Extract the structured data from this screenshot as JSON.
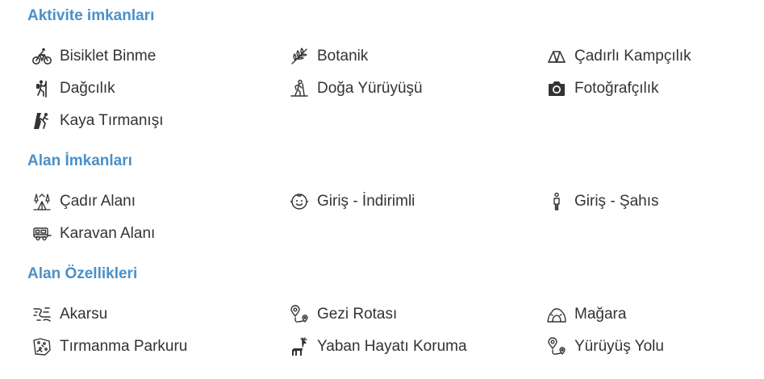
{
  "sections": {
    "activity": {
      "title": "Aktivite imkanları",
      "items": [
        {
          "label": "Bisiklet Binme",
          "icon": "bicycle-icon"
        },
        {
          "label": "Botanik",
          "icon": "leaf-icon"
        },
        {
          "label": "Çadırlı Kampçılık",
          "icon": "tent-icon"
        },
        {
          "label": "Dağcılık",
          "icon": "climber-icon"
        },
        {
          "label": "Doğa Yürüyüşü",
          "icon": "hiker-icon"
        },
        {
          "label": "Fotoğrafçılık",
          "icon": "camera-icon"
        },
        {
          "label": "Kaya Tırmanışı",
          "icon": "rock-climbing-icon"
        }
      ]
    },
    "facilities": {
      "title": "Alan İmkanları",
      "items": [
        {
          "label": "Çadır Alanı",
          "icon": "camp-area-icon"
        },
        {
          "label": "Giriş - İndirimli",
          "icon": "child-face-icon"
        },
        {
          "label": "Giriş - Şahıs",
          "icon": "person-icon"
        },
        {
          "label": "Karavan Alanı",
          "icon": "caravan-icon"
        }
      ]
    },
    "features": {
      "title": "Alan Özellikleri",
      "items": [
        {
          "label": "Akarsu",
          "icon": "river-icon"
        },
        {
          "label": "Gezi Rotası",
          "icon": "route-icon"
        },
        {
          "label": "Mağara",
          "icon": "cave-icon"
        },
        {
          "label": "Tırmanma Parkuru",
          "icon": "climbing-wall-icon"
        },
        {
          "label": "Yaban Hayatı Koruma",
          "icon": "deer-icon"
        },
        {
          "label": "Yürüyüş Yolu",
          "icon": "trail-icon"
        }
      ]
    }
  }
}
